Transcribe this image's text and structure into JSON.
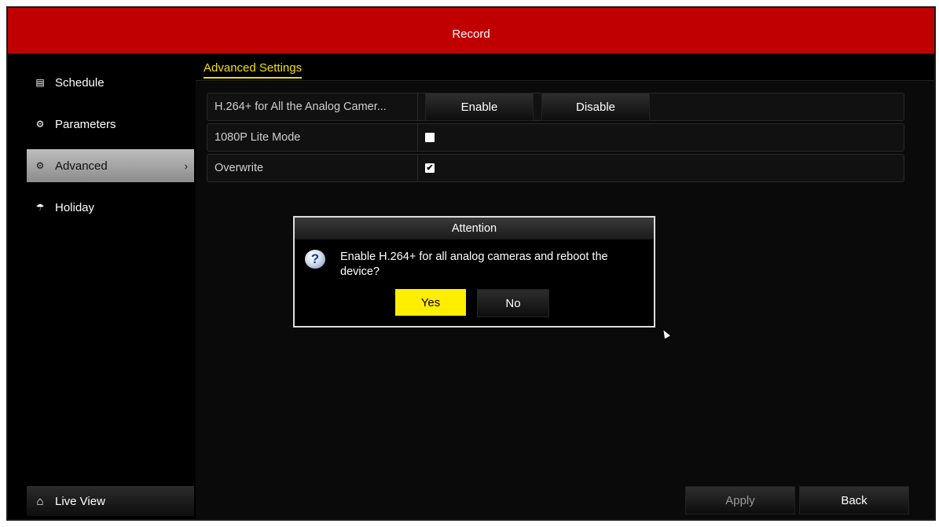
{
  "window": {
    "title": "Record"
  },
  "sidebar": {
    "items": [
      {
        "label": "Schedule",
        "icon": "calendar-icon",
        "glyph": "▤"
      },
      {
        "label": "Parameters",
        "icon": "gear-icon",
        "glyph": "⚙"
      },
      {
        "label": "Advanced",
        "icon": "advanced-gears-icon",
        "glyph": "⚙",
        "active": true,
        "arrow": "›"
      },
      {
        "label": "Holiday",
        "icon": "umbrella-icon",
        "glyph": "☂"
      }
    ],
    "live_view": {
      "label": "Live View",
      "icon": "home-icon",
      "glyph": "⌂"
    }
  },
  "tabs": [
    {
      "label": "Advanced Settings",
      "active": true
    }
  ],
  "settings": {
    "h264": {
      "label": "H.264+ for All the Analog Camer...",
      "enable": "Enable",
      "disable": "Disable"
    },
    "lite_mode": {
      "label": "1080P Lite Mode",
      "checked": false,
      "mark": ""
    },
    "overwrite": {
      "label": "Overwrite",
      "checked": true,
      "mark": "✔"
    }
  },
  "footer": {
    "apply": "Apply",
    "back": "Back"
  },
  "dialog": {
    "title": "Attention",
    "icon": "question-icon",
    "glyph": "?",
    "message": "Enable H.264+ for all analog cameras and reboot the device?",
    "yes": "Yes",
    "no": "No"
  },
  "colors": {
    "titlebar": "#c00000",
    "accent": "#f0e000",
    "yes_button": "#ffee00"
  }
}
